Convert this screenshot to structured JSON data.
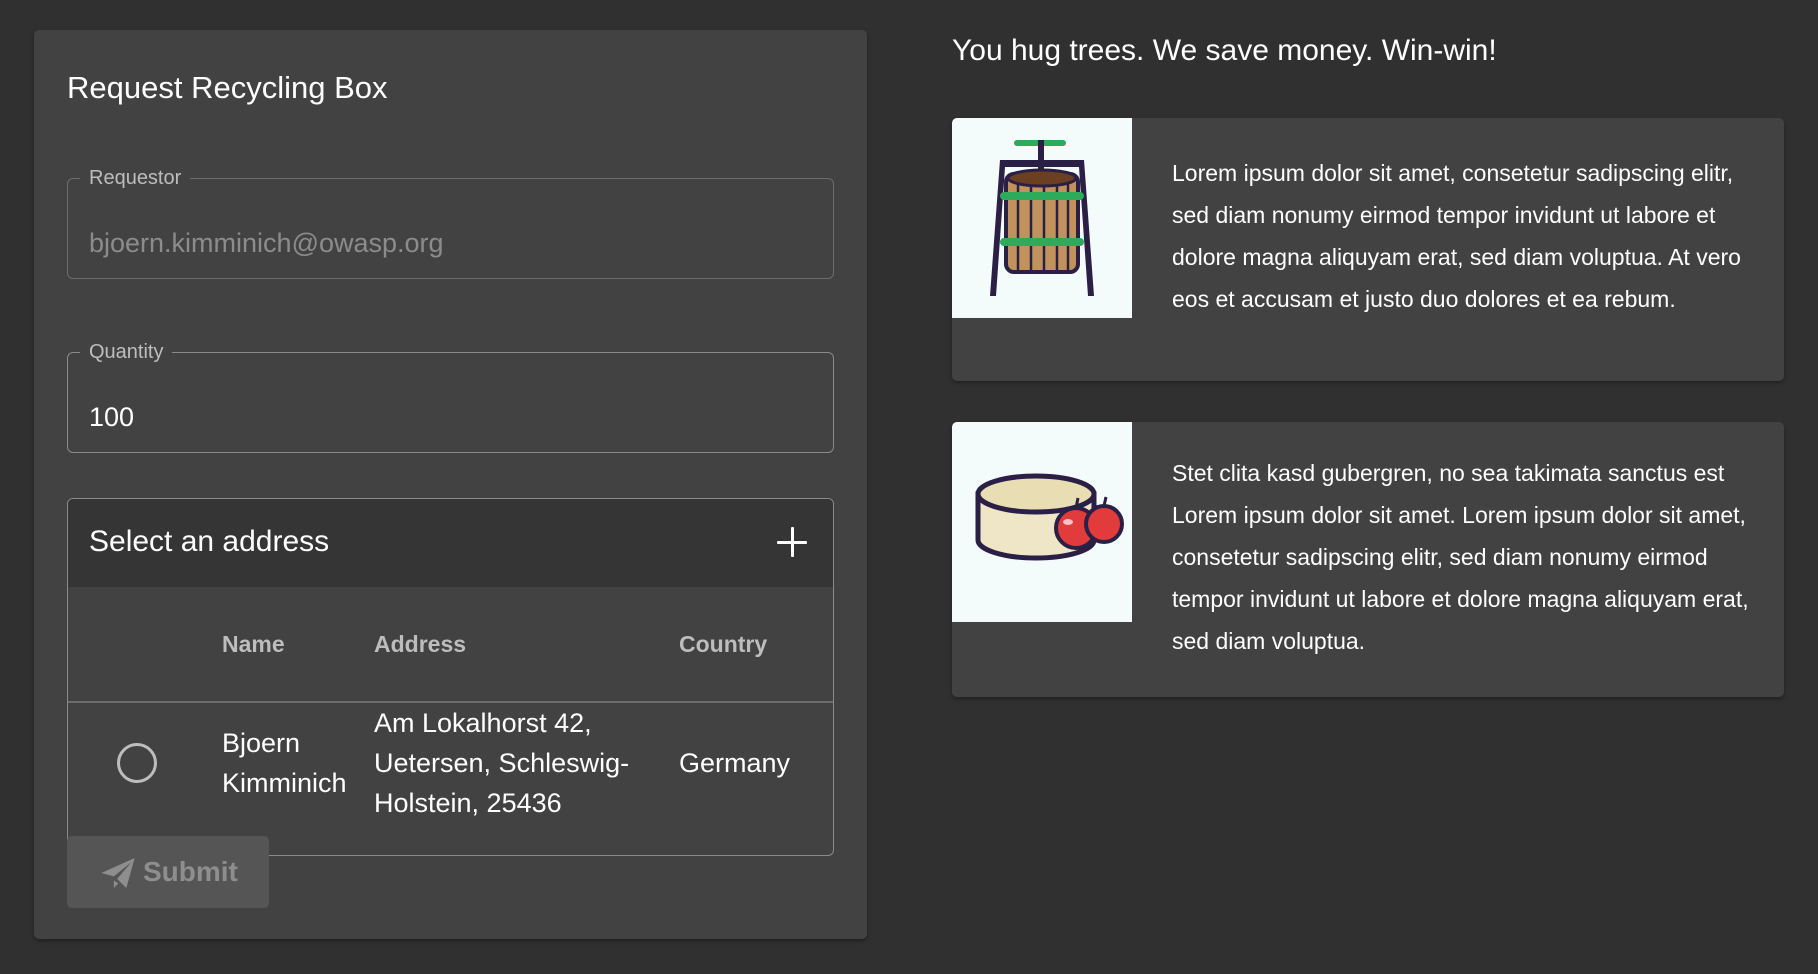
{
  "form": {
    "title": "Request Recycling Box",
    "requestor": {
      "label": "Requestor",
      "value": "bjoern.kimminich@owasp.org"
    },
    "quantity": {
      "label": "Quantity",
      "value": "100"
    },
    "address": {
      "title": "Select an address",
      "columns": {
        "name": "Name",
        "address": "Address",
        "country": "Country"
      },
      "rows": [
        {
          "name_line1": "Bjoern",
          "name_line2": "Kimminich",
          "address_line1": "Am Lokalhorst 42,",
          "address_line2": "Uetersen, Schleswig-",
          "address_line3": "Holstein, 25436",
          "country": "Germany"
        }
      ]
    },
    "submit_label": "Submit"
  },
  "info": {
    "tagline": "You hug trees. We save money. Win-win!",
    "cards": [
      {
        "image_icon": "fruit-press-icon",
        "text": "Lorem ipsum dolor sit amet, consetetur sadipscing elitr, sed diam nonumy eirmod tempor invidunt ut labore et dolore magna aliquyam erat, sed diam voluptua. At vero eos et accusam et justo duo dolores et ea rebum."
      },
      {
        "image_icon": "apple-pomace-icon",
        "text": "Stet clita kasd gubergren, no sea takimata sanctus est Lorem ipsum dolor sit amet. Lorem ipsum dolor sit amet, consetetur sadipscing elitr, sed diam nonumy eirmod tempor invidunt ut labore et dolore magna aliquyam erat, sed diam voluptua."
      }
    ]
  },
  "colors": {
    "background": "#303030",
    "card": "#424242",
    "panel_header": "#353535",
    "disabled_button": "#555555",
    "muted_text": "#bdbdbd",
    "image_background": "#f3fbfb"
  }
}
